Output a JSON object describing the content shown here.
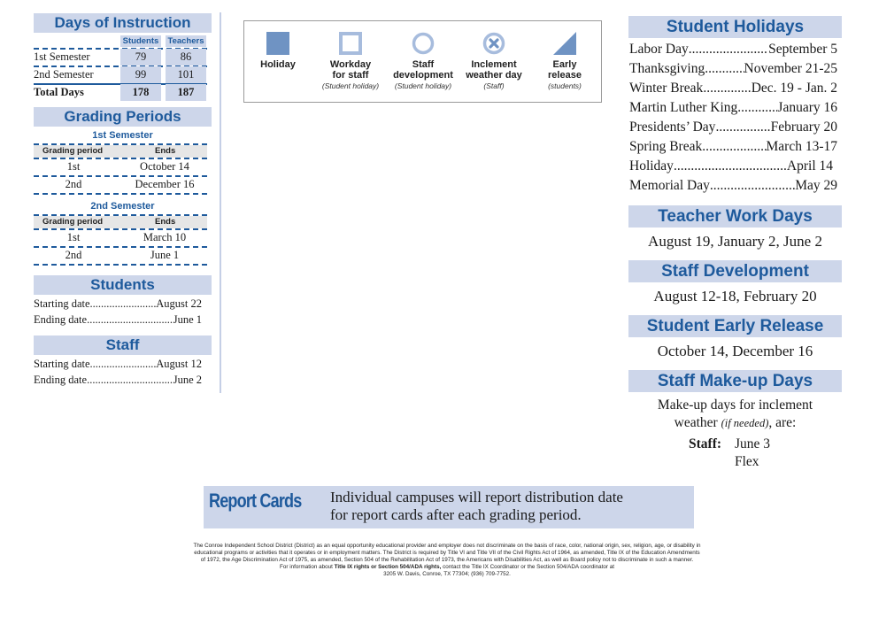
{
  "days_of_instruction": {
    "title": "Days of Instruction",
    "columns": [
      "Students",
      "Teachers"
    ],
    "rows": [
      {
        "label": "1st Semester",
        "students": "79",
        "teachers": "86"
      },
      {
        "label": "2nd Semester",
        "students": "99",
        "teachers": "101"
      },
      {
        "label": "Total Days",
        "students": "178",
        "teachers": "187"
      }
    ]
  },
  "grading_periods": {
    "title": "Grading Periods",
    "col_period": "Grading period",
    "col_ends": "Ends",
    "semesters": [
      {
        "title": "1st Semester",
        "rows": [
          {
            "period": "1st",
            "ends": "October 14"
          },
          {
            "period": "2nd",
            "ends": "December 16"
          }
        ]
      },
      {
        "title": "2nd Semester",
        "rows": [
          {
            "period": "1st",
            "ends": "March 10"
          },
          {
            "period": "2nd",
            "ends": "June 1"
          }
        ]
      }
    ]
  },
  "students": {
    "title": "Students",
    "start_label": "Starting date",
    "start_value": "August 22",
    "end_label": "Ending date",
    "end_value": "June 1"
  },
  "staff": {
    "title": "Staff",
    "start_label": "Starting date",
    "start_value": "August 12",
    "end_label": "Ending date",
    "end_value": "June 2"
  },
  "legend": {
    "items": [
      {
        "icon": "filled-square",
        "label": "Holiday",
        "sub": ""
      },
      {
        "icon": "hollow-square",
        "label": "Workday\nfor staff",
        "sub": "(Student holiday)"
      },
      {
        "icon": "circle",
        "label": "Staff\ndevelopment",
        "sub": "(Student holiday)"
      },
      {
        "icon": "circle-x",
        "label": "Inclement\nweather day",
        "sub": "(Staff)"
      },
      {
        "icon": "triangle",
        "label": "Early\nrelease",
        "sub": "(students)"
      }
    ],
    "color": "#6f93c3",
    "color_light": "#a7bcdd"
  },
  "student_holidays": {
    "title": "Student Holidays",
    "items": [
      {
        "name": "Labor Day",
        "date": "September 5"
      },
      {
        "name": "Thanksgiving",
        "date": "November 21-25"
      },
      {
        "name": "Winter Break",
        "date": "Dec. 19 - Jan. 2"
      },
      {
        "name": "Martin Luther King",
        "date": "January 16"
      },
      {
        "name": "Presidents’ Day",
        "date": "February 20"
      },
      {
        "name": "Spring Break",
        "date": "March 13-17"
      },
      {
        "name": "Holiday",
        "date": "April 14"
      },
      {
        "name": "Memorial Day",
        "date": "May 29"
      }
    ]
  },
  "teacher_work_days": {
    "title": "Teacher Work Days",
    "dates": "August 19, January 2, June 2"
  },
  "staff_development": {
    "title": "Staff Development",
    "dates": "August 12-18, February 20"
  },
  "student_early_release": {
    "title": "Student Early Release",
    "dates": "October 14, December 16"
  },
  "staff_makeup_days": {
    "title": "Staff Make-up Days",
    "line1": "Make-up days for inclement",
    "line2_a": "weather ",
    "line2_italic": "(if needed)",
    "line2_b": ", are:",
    "staff_label": "Staff:",
    "dates": [
      "June 3",
      "Flex"
    ]
  },
  "report_cards": {
    "title": "Report Cards",
    "line1": "Individual campuses will report distribution date",
    "line2": "for report cards after each grading period."
  },
  "footer": {
    "line1": "The Conroe Independent School District (District) as an equal opportunity educational provider and employer does not discriminate on the basis of race, color, national origin, sex, religion, age, or disability in",
    "line2": "educational programs or activities that it operates or in employment matters. The District is required by Title VI and Title VII of the Civil Rights Act of 1964, as amended, Title IX of the Education Amendments",
    "line3": "of 1972, the Age Discrimination Act of 1975, as amended, Section 504 of the Rehabilitation Act of 1973, the Americans with Disabilities Act, as well as Board policy not to discriminate in such a manner.",
    "line4_a": "For information about ",
    "line4_bold": "Title IX rights or Section 504/ADA rights,",
    "line4_b": " contact the Title IX Coordinator or the Section 504/ADA coordinator at",
    "line5": "3205 W. Davis, Conroe, TX 77304; (936) 709-7752."
  },
  "colors": {
    "header_bg": "#cdd6ea",
    "header_text": "#1e5a9c",
    "divider": "#c5cfe6"
  }
}
